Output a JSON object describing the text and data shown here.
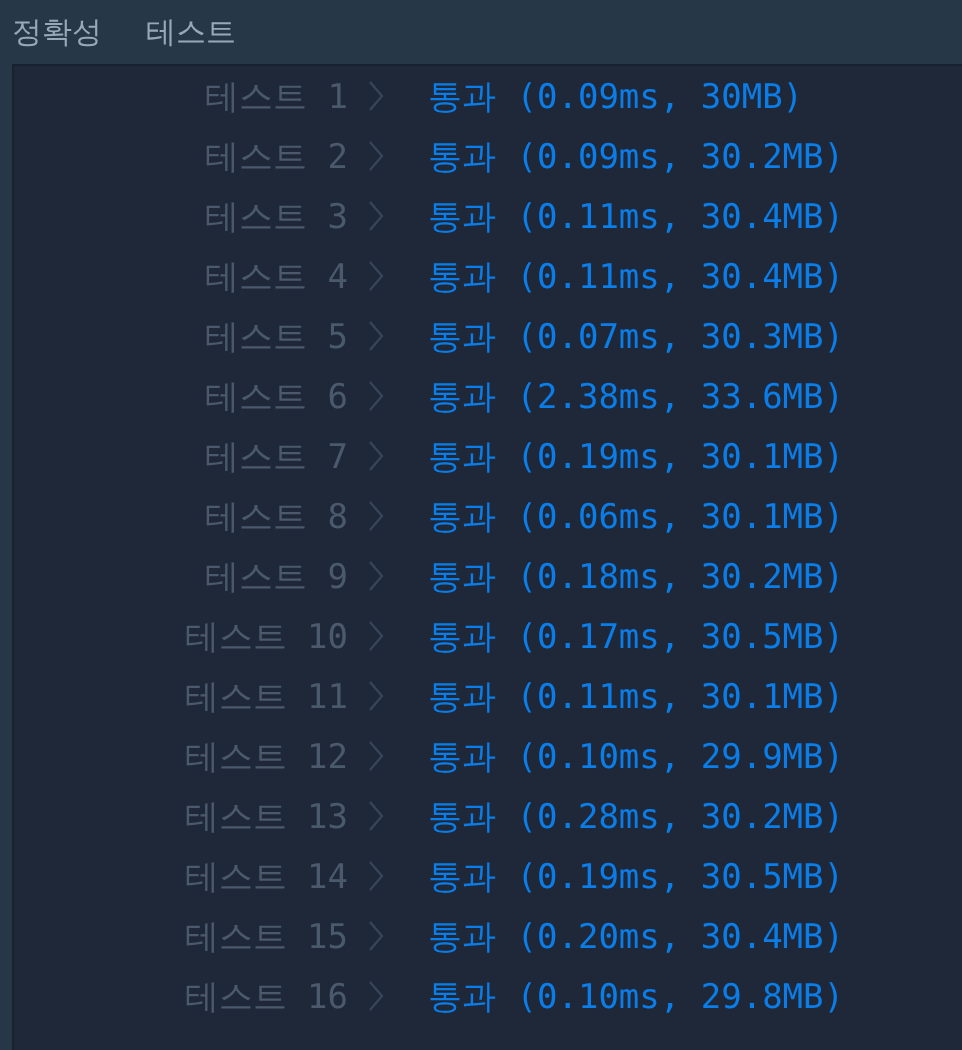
{
  "tabs": [
    {
      "label": "정확성"
    },
    {
      "label": "테스트"
    }
  ],
  "results": [
    {
      "label": "테스트 1",
      "result": "통과",
      "detail": "(0.09ms, 30MB)"
    },
    {
      "label": "테스트 2",
      "result": "통과",
      "detail": "(0.09ms, 30.2MB)"
    },
    {
      "label": "테스트 3",
      "result": "통과",
      "detail": "(0.11ms, 30.4MB)"
    },
    {
      "label": "테스트 4",
      "result": "통과",
      "detail": "(0.11ms, 30.4MB)"
    },
    {
      "label": "테스트 5",
      "result": "통과",
      "detail": "(0.07ms, 30.3MB)"
    },
    {
      "label": "테스트 6",
      "result": "통과",
      "detail": "(2.38ms, 33.6MB)"
    },
    {
      "label": "테스트 7",
      "result": "통과",
      "detail": "(0.19ms, 30.1MB)"
    },
    {
      "label": "테스트 8",
      "result": "통과",
      "detail": "(0.06ms, 30.1MB)"
    },
    {
      "label": "테스트 9",
      "result": "통과",
      "detail": "(0.18ms, 30.2MB)"
    },
    {
      "label": "테스트 10",
      "result": "통과",
      "detail": "(0.17ms, 30.5MB)"
    },
    {
      "label": "테스트 11",
      "result": "통과",
      "detail": "(0.11ms, 30.1MB)"
    },
    {
      "label": "테스트 12",
      "result": "통과",
      "detail": "(0.10ms, 29.9MB)"
    },
    {
      "label": "테스트 13",
      "result": "통과",
      "detail": "(0.28ms, 30.2MB)"
    },
    {
      "label": "테스트 14",
      "result": "통과",
      "detail": "(0.19ms, 30.5MB)"
    },
    {
      "label": "테스트 15",
      "result": "통과",
      "detail": "(0.20ms, 30.4MB)"
    },
    {
      "label": "테스트 16",
      "result": "통과",
      "detail": "(0.10ms, 29.8MB)"
    }
  ]
}
